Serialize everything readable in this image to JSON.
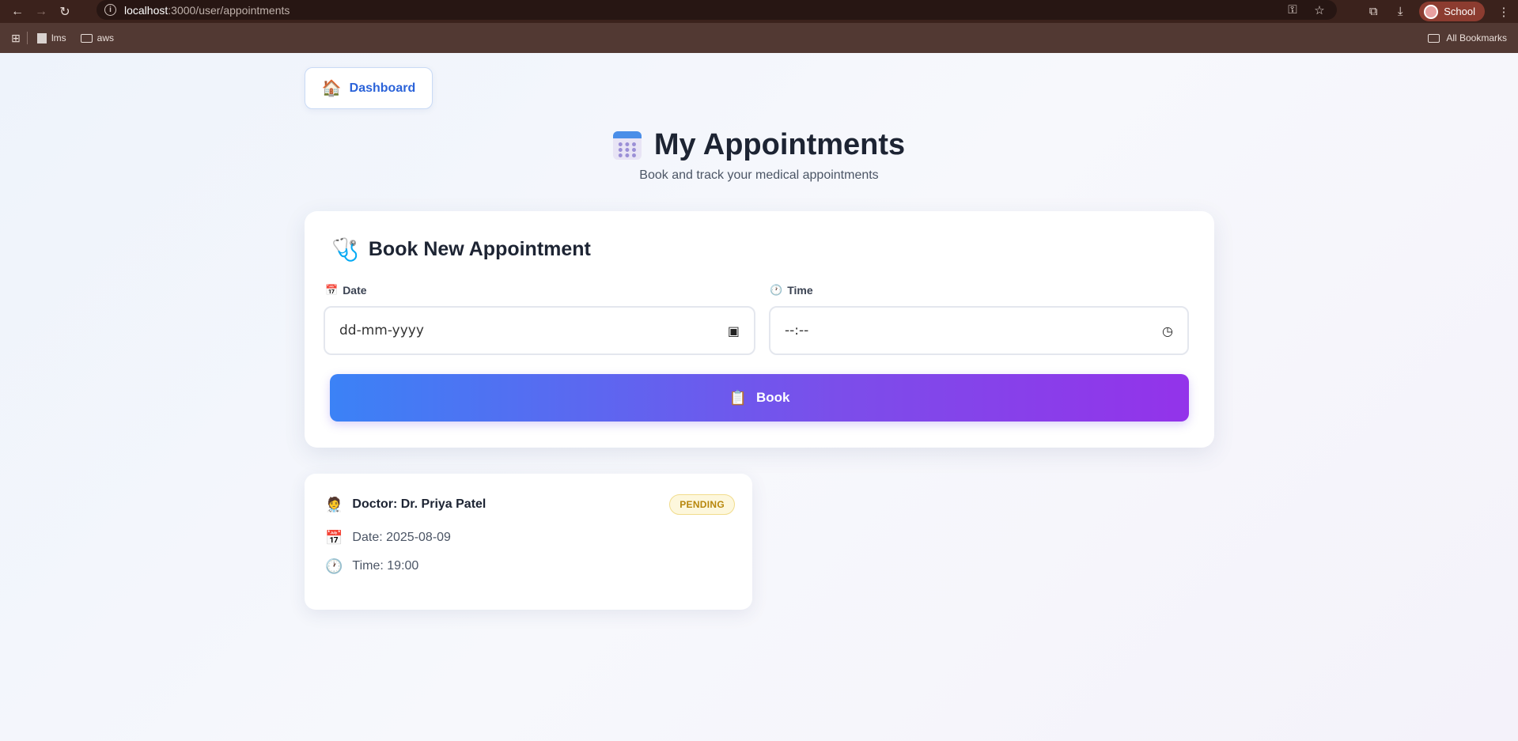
{
  "browser": {
    "url_host": "localhost",
    "url_path": ":3000/user/appointments",
    "bookmarks": [
      {
        "label": "lms"
      },
      {
        "label": "aws"
      }
    ],
    "all_bookmarks_label": "All Bookmarks",
    "profile_label": "School"
  },
  "nav": {
    "dashboard_label": "Dashboard",
    "dashboard_icon": "house-emoji"
  },
  "header": {
    "title": "My Appointments",
    "subtitle": "Book and track your medical appointments"
  },
  "booking": {
    "heading": "Book New Appointment",
    "date_label": "Date",
    "date_placeholder": "dd-mm-yyyy",
    "time_label": "Time",
    "time_placeholder": "--:--",
    "book_label": "Book"
  },
  "appointments": [
    {
      "doctor": "Doctor: Dr. Priya Patel",
      "status": "PENDING",
      "date": "Date: 2025-08-09",
      "time": "Time: 19:00"
    }
  ],
  "colors": {
    "accent": "#2b63d9",
    "gradient_start": "#3b82f6",
    "gradient_end": "#9333ea",
    "pending": "#b7860b"
  }
}
